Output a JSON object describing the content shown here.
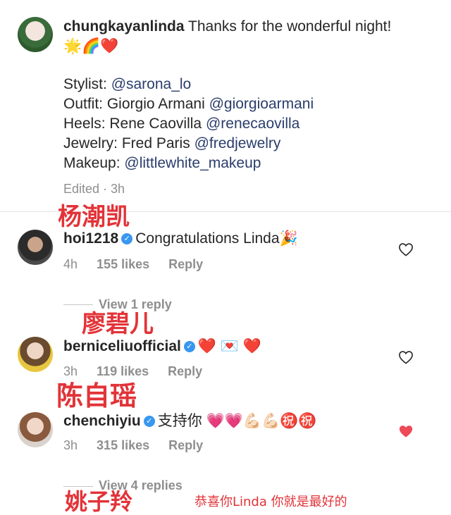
{
  "caption": {
    "username": "chungkayanlinda",
    "text": "Thanks for the wonderful night!",
    "emojis": "🌟🌈❤️",
    "credits": [
      {
        "label": "Stylist:",
        "mention": "@sarona_lo"
      },
      {
        "label": "Outfit: Giorgio Armani",
        "mention": "@giorgioarmani"
      },
      {
        "label": "Heels: Rene Caovilla",
        "mention": "@renecaovilla"
      },
      {
        "label": "Jewelry: Fred Paris",
        "mention": "@fredjewelry"
      },
      {
        "label": "Makeup:",
        "mention": "@littlewhite_makeup"
      }
    ],
    "meta": "Edited · 3h"
  },
  "comments": [
    {
      "cn_name": "杨潮凯",
      "username": "hoi1218",
      "text": "Congratulations Linda",
      "emoji": "🎉",
      "time": "4h",
      "likes": "155 likes",
      "reply": "Reply",
      "view_replies": "View 1 reply",
      "liked": false
    },
    {
      "cn_name": "廖碧儿",
      "username": "berniceliuofficial",
      "text": "",
      "emoji": "❤️ 💌 ❤️",
      "time": "3h",
      "likes": "119 likes",
      "reply": "Reply",
      "view_replies": "",
      "liked": false
    },
    {
      "cn_name": "陈自瑶",
      "username": "chenchiyiu",
      "text": "支持你",
      "emoji": "💗💗💪🏻💪🏻㊗️㊗️",
      "time": "3h",
      "likes": "315 likes",
      "reply": "Reply",
      "view_replies": "View 4 replies",
      "liked": true
    }
  ],
  "bottom": {
    "cn_name": "姚子羚",
    "cn_caption": "恭喜你Linda 你就是最好的"
  },
  "colors": {
    "like_red": "#ed4956",
    "mention": "#2a3d6b",
    "verified": "#3897f0",
    "cn_red": "#e23338"
  }
}
